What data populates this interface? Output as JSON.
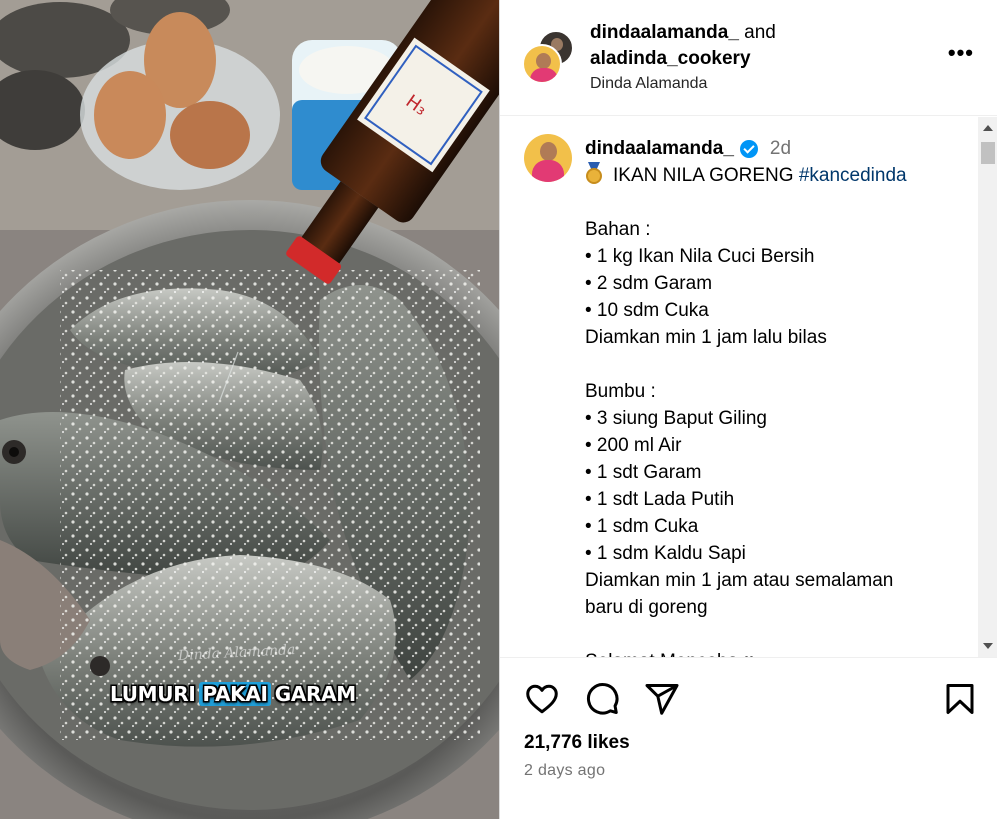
{
  "media": {
    "caption_words": [
      "LUMURI",
      "PAKAI",
      "GARAM"
    ],
    "watermark": "Dinda Alamanda",
    "bottle_label_text": "H₃"
  },
  "header": {
    "user1": "dindaalamanda_",
    "joiner": "and",
    "user2": "aladinda_cookery",
    "subtitle": "Dinda Alamanda",
    "more_label": "•••"
  },
  "caption": {
    "username": "dindaalamanda_",
    "time": "2d",
    "title": "IKAN NILA GORENG",
    "hashtag": "#kancedinda",
    "lines": [
      "",
      "Bahan :",
      "• 1 kg Ikan Nila Cuci Bersih",
      "• 2 sdm Garam",
      "• 10 sdm Cuka",
      "Diamkan min 1 jam lalu bilas",
      "",
      "Bumbu :",
      "• 3 siung Baput Giling",
      "• 200 ml Air",
      "• 1 sdt Garam",
      "• 1 sdt Lada Putih",
      "• 1 sdm Cuka",
      "• 1 sdm Kaldu Sapi",
      "Diamkan min 1 jam atau semalaman",
      "baru di goreng",
      "",
      "Selamat Mencoba ♥"
    ]
  },
  "footer": {
    "likes": "21,776 likes",
    "posted": "2 days ago"
  },
  "icons": [
    "heart-icon",
    "comment-icon",
    "share-icon",
    "bookmark-icon",
    "verified-icon",
    "medal-icon",
    "more-icon"
  ],
  "colors": {
    "accent_link": "#00376b",
    "verified": "#0095f6",
    "muted_text": "#737373",
    "caption_highlight": "#1f9fd9"
  }
}
